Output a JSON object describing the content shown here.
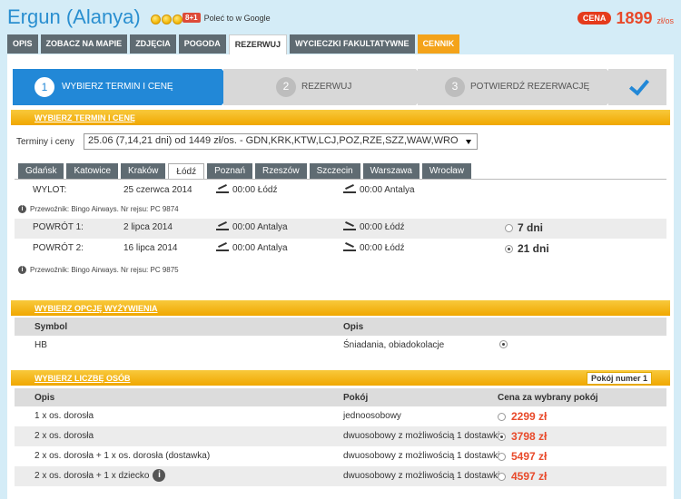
{
  "header": {
    "hotel_name": "Ergun (Alanya)",
    "gplus_label": "8+1",
    "gplus_text": "Poleć to w Google",
    "price_badge": "CENA",
    "price_value": "1899",
    "price_unit": "zł/os"
  },
  "nav": {
    "tabs": [
      {
        "label": "OPIS"
      },
      {
        "label": "ZOBACZ NA MAPIE"
      },
      {
        "label": "ZDJĘCIA"
      },
      {
        "label": "POGODA"
      },
      {
        "label": "REZERWUJ"
      },
      {
        "label": "WYCIECZKI FAKULTATYWNE"
      },
      {
        "label": "CENNIK"
      }
    ]
  },
  "steps": {
    "step1": {
      "num": "1",
      "label": "WYBIERZ TERMIN I CENĘ"
    },
    "step2": {
      "num": "2",
      "label": "REZERWUJ"
    },
    "step3": {
      "num": "3",
      "label": "POTWIERDŹ REZERWACJĘ"
    }
  },
  "sections": {
    "term": "WYBIERZ TERMIN I CENĘ",
    "meal": "WYBIERZ OPCJĘ WYŻYWIENIA",
    "persons": "WYBIERZ LICZBĘ OSÓB",
    "room_badge": "Pokój numer 1"
  },
  "terms": {
    "label": "Terminy i ceny",
    "selected": "25.06 (7,14,21 dni) od 1449 zł/os. - GDN,KRK,KTW,LCJ,POZ,RZE,SZZ,WAW,WRO"
  },
  "city_tabs": [
    {
      "label": "Gdańsk"
    },
    {
      "label": "Katowice"
    },
    {
      "label": "Kraków"
    },
    {
      "label": "Łódź"
    },
    {
      "label": "Poznań"
    },
    {
      "label": "Rzeszów"
    },
    {
      "label": "Szczecin"
    },
    {
      "label": "Warszawa"
    },
    {
      "label": "Wrocław"
    }
  ],
  "flights": {
    "out": {
      "label": "WYLOT:",
      "date": "25 czerwca 2014",
      "dep": "00:00 Łódź",
      "arr": "00:00 Antalya"
    },
    "carrier1": "Przewoźnik: Bingo Airways. Nr rejsu: PC 9874",
    "ret1": {
      "label": "POWRÓT 1:",
      "date": "2 lipca 2014",
      "dep": "00:00 Antalya",
      "arr": "00:00 Łódź",
      "days": "7 dni"
    },
    "ret2": {
      "label": "POWRÓT 2:",
      "date": "16 lipca 2014",
      "dep": "00:00 Antalya",
      "arr": "00:00 Łódź",
      "days": "21 dni"
    },
    "carrier2": "Przewoźnik: Bingo Airways. Nr rejsu: PC 9875"
  },
  "meal": {
    "col_symbol": "Symbol",
    "col_desc": "Opis",
    "row": {
      "symbol": "HB",
      "desc": "Śniadania, obiadokolacje"
    }
  },
  "persons": {
    "col_desc": "Opis",
    "col_room": "Pokój",
    "col_price": "Cena za wybrany pokój",
    "rows": [
      {
        "desc": "1 x os. dorosła",
        "room": "jednoosobowy",
        "price": "2299 zł"
      },
      {
        "desc": "2 x os. dorosła",
        "room": "dwuosobowy z możliwością 1 dostawki",
        "price": "3798 zł"
      },
      {
        "desc": "2 x os. dorosła + 1 x os. dorosła (dostawka)",
        "room": "dwuosobowy z możliwością 1 dostawki",
        "price": "5497 zł"
      },
      {
        "desc": "2 x os. dorosła + 1 x dziecko",
        "room": "dwuosobowy z możliwością 1 dostawki",
        "price": "4597 zł"
      }
    ]
  }
}
